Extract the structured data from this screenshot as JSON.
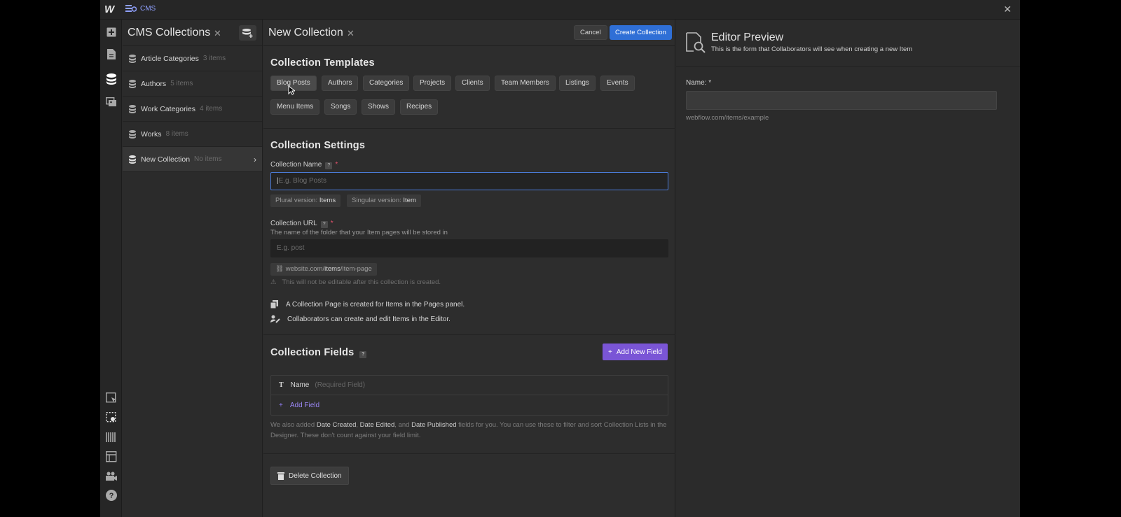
{
  "topbar": {
    "breadcrumb": "CMS",
    "logo": "W"
  },
  "collections_panel": {
    "title": "CMS Collections",
    "items": [
      {
        "label": "Article Categories",
        "count": "3 items"
      },
      {
        "label": "Authors",
        "count": "5 items"
      },
      {
        "label": "Work Categories",
        "count": "4 items"
      },
      {
        "label": "Works",
        "count": "8 items"
      },
      {
        "label": "New Collection",
        "count": "No items"
      }
    ]
  },
  "form": {
    "title": "New Collection",
    "cancel_label": "Cancel",
    "create_label": "Create Collection",
    "templates": {
      "title": "Collection Templates",
      "items": [
        "Blog Posts",
        "Authors",
        "Categories",
        "Projects",
        "Clients",
        "Team Members",
        "Listings",
        "Events",
        "Menu Items",
        "Songs",
        "Shows",
        "Recipes"
      ]
    },
    "settings": {
      "title": "Collection Settings",
      "name_label": "Collection Name",
      "name_placeholder": "E.g. Blog Posts",
      "plural_label": "Plural version:",
      "plural_value": "Items",
      "singular_label": "Singular version:",
      "singular_value": "Item",
      "url_label": "Collection URL",
      "url_help": "The name of the folder that your Item pages will be stored in",
      "url_placeholder": "E.g. post",
      "url_preview_prefix": "website.com/",
      "url_preview_folder": "items",
      "url_preview_suffix": "/item-page",
      "warning": "This will not be editable after this collection is created.",
      "info_pages": "A Collection Page is created for Items in the Pages panel.",
      "info_collab": "Collaborators can create and edit Items in the Editor."
    },
    "fields": {
      "title": "Collection Fields",
      "add_new_label": "Add New Field",
      "name_field": "Name",
      "name_field_note": "(Required Field)",
      "add_field_label": "Add Field",
      "note_1": "We also added ",
      "note_date_created": "Date Created",
      "note_sep1": ", ",
      "note_date_edited": "Date Edited",
      "note_sep2": ", and ",
      "note_date_published": "Date Published",
      "note_2": " fields for you. You can use these to filter and sort Collection Lists in the Designer. These don't count against your field limit."
    },
    "delete_label": "Delete Collection"
  },
  "preview": {
    "title": "Editor Preview",
    "subtitle": "This is the form that Collaborators will see when creating a new Item",
    "name_label": "Name: *",
    "url_example": "webflow.com/items/example"
  },
  "colors": {
    "accent_blue": "#2f6fd6",
    "accent_purple": "#7a55d6",
    "required_red": "#e0526b",
    "focus_blue": "#4b7bd8"
  }
}
